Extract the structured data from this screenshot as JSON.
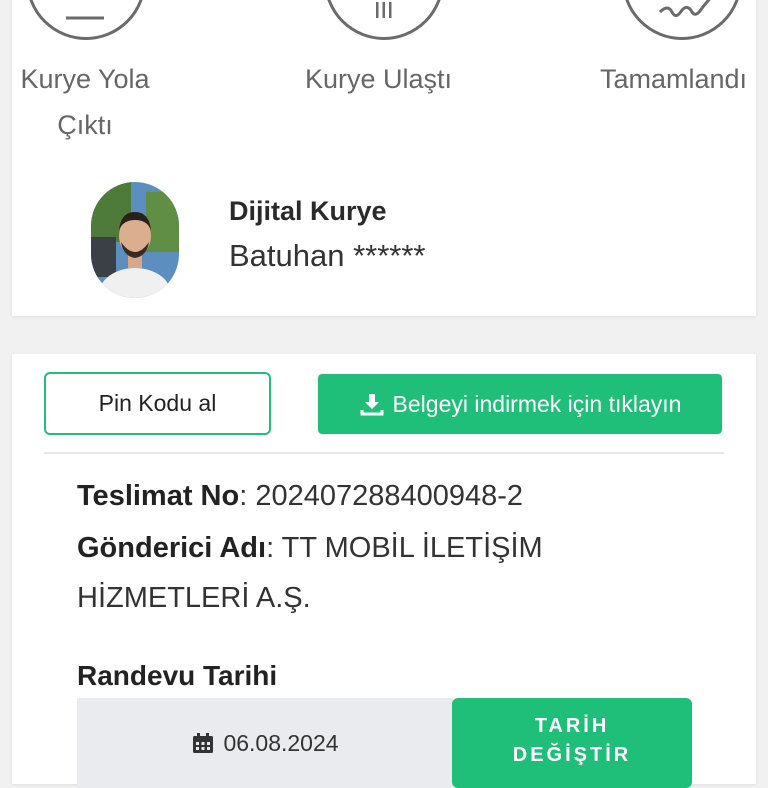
{
  "steps": [
    {
      "label_line1": "Kurye Yola",
      "label_line2": "Çıktı",
      "icon": "scooter-icon"
    },
    {
      "label_line1": "Kurye Ulaştı",
      "icon": "building-icon"
    },
    {
      "label_line1": "Tamamlandı",
      "icon": "signature-icon"
    }
  ],
  "courier": {
    "role": "Dijital Kurye",
    "name": "Batuhan ******"
  },
  "actions": {
    "pin_label": "Pin Kodu al",
    "download_label": "Belgeyi indirmek için tıklayın",
    "download_icon": "download-icon"
  },
  "shipment": {
    "delivery_no_label": "Teslimat No",
    "delivery_no_value": ": 202407288400948-2",
    "sender_label": "Gönderici Adı",
    "sender_value_line1": ": TT MOBİL İLETİŞİM",
    "sender_value_line2": "HİZMETLERİ A.Ş."
  },
  "appointment": {
    "title": "Randevu Tarihi",
    "date": "06.08.2024",
    "date_icon": "calendar-icon",
    "change_line1": "TARİH",
    "change_line2": "DEĞİŞTİR"
  },
  "colors": {
    "accent": "#1fbf7a",
    "circle_border": "#6b6b6b"
  }
}
